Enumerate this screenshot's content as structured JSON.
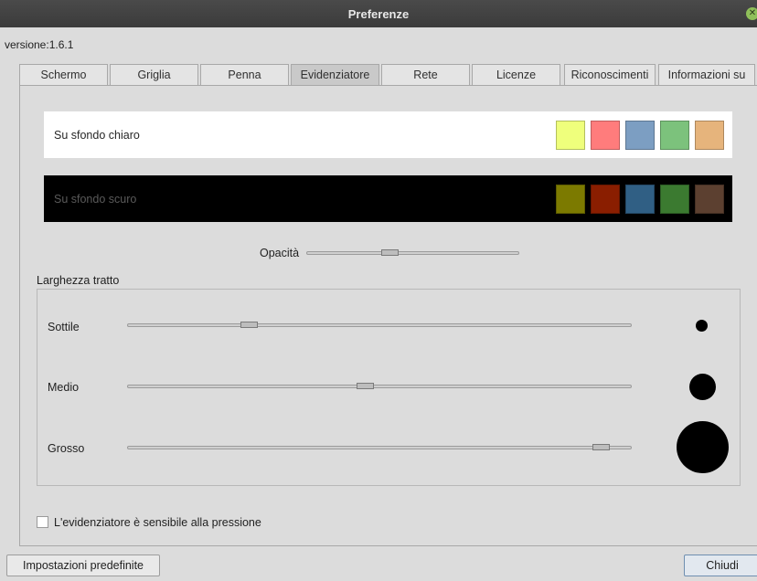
{
  "window": {
    "title": "Preferenze",
    "close_icon": "close-icon"
  },
  "version": "versione:1.6.1",
  "tabs": [
    {
      "label": "Schermo",
      "active": false
    },
    {
      "label": "Griglia",
      "active": false
    },
    {
      "label": "Penna",
      "active": false
    },
    {
      "label": "Evidenziatore",
      "active": true
    },
    {
      "label": "Rete",
      "active": false
    },
    {
      "label": "Licenze",
      "active": false
    },
    {
      "label": "Riconoscimenti",
      "active": false
    },
    {
      "label": "Informazioni su",
      "active": false
    }
  ],
  "light_row": {
    "label": "Su sfondo chiaro",
    "colors": [
      "#efff7c",
      "#ff7c7c",
      "#7c9ec2",
      "#7cc27c",
      "#e6b47c"
    ]
  },
  "dark_row": {
    "label": "Su sfondo scuro",
    "colors": [
      "#7c7a00",
      "#8a1e00",
      "#305f84",
      "#3b7a30",
      "#5c4030"
    ]
  },
  "opacity": {
    "label": "Opacità",
    "value": 0.39
  },
  "stroke_width": {
    "title": "Larghezza tratto",
    "items": [
      {
        "label": "Sottile",
        "value": 0.24
      },
      {
        "label": "Medio",
        "value": 0.47
      },
      {
        "label": "Grosso",
        "value": 0.94
      }
    ]
  },
  "pressure": {
    "label": "L'evidenziatore è sensibile alla pressione",
    "checked": false
  },
  "buttons": {
    "defaults": "Impostazioni predefinite",
    "close": "Chiudi"
  }
}
